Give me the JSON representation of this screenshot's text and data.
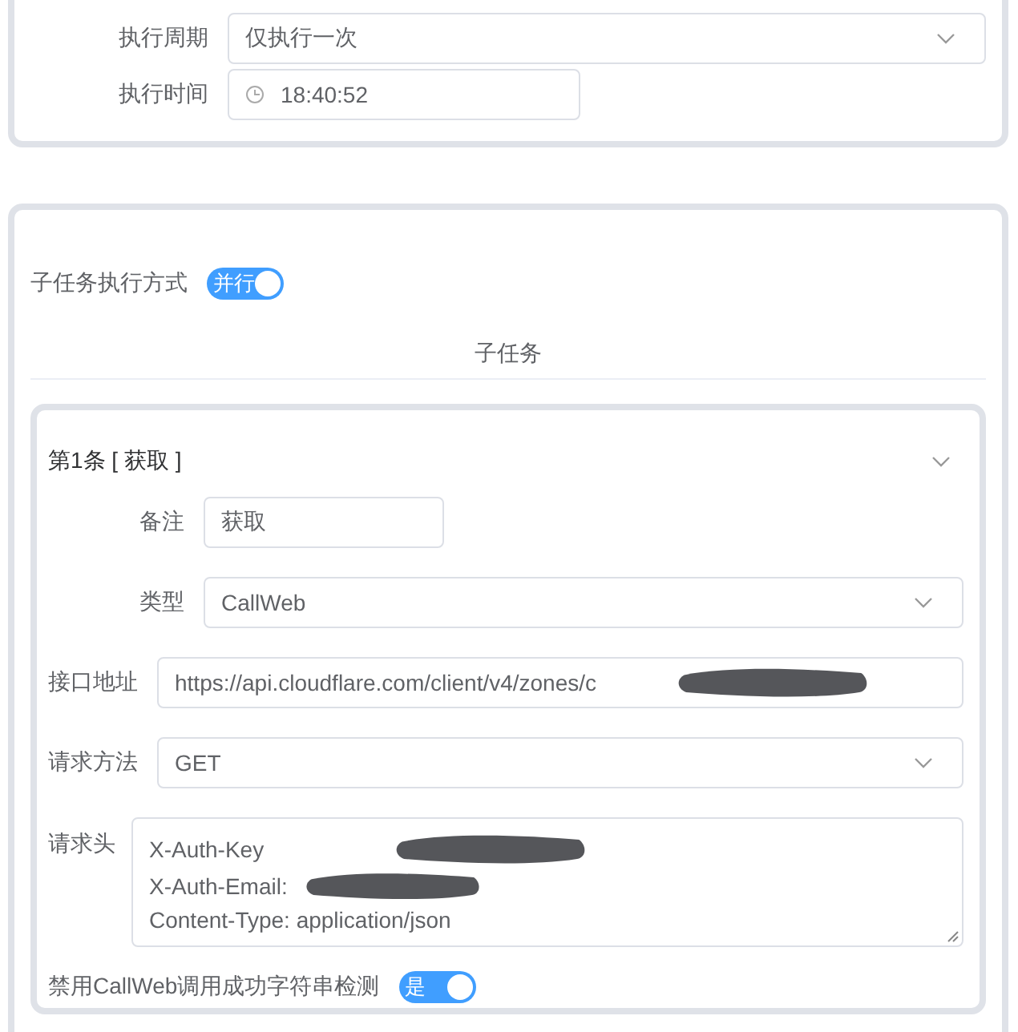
{
  "schedule_card": {
    "fields": [
      {
        "kind": "select",
        "label": "执行周期",
        "value": "仅执行一次"
      },
      {
        "kind": "time",
        "label": "执行时间",
        "value": "18:40:52"
      }
    ]
  },
  "subtask_card": {
    "mode": {
      "label": "子任务执行方式",
      "on": true,
      "text": "并行"
    },
    "divider_title": "子任务",
    "subtasks": [
      {
        "title": "第1条 [ 获取 ]",
        "expanded": true,
        "basic_fields": [
          {
            "kind": "input",
            "label": "备注",
            "value": "获取"
          },
          {
            "kind": "select",
            "label": "类型",
            "value": "CallWeb"
          }
        ],
        "request_fields": [
          {
            "kind": "input",
            "label": "接口地址",
            "value": "https://api.cloudflare.com/client/v4/zones/c",
            "redacted": true
          },
          {
            "kind": "select",
            "label": "请求方法",
            "value": "GET"
          },
          {
            "kind": "textarea",
            "label": "请求头",
            "lines": [
              {
                "text": "X-Auth-Key",
                "redacted": true
              },
              {
                "text": "X-Auth-Email:",
                "redacted": true
              },
              {
                "text": "Content-Type: application/json"
              }
            ]
          }
        ],
        "check_switch": {
          "label": "禁用CallWeb调用成功字符串检测",
          "on": true,
          "text": "是"
        }
      }
    ]
  }
}
